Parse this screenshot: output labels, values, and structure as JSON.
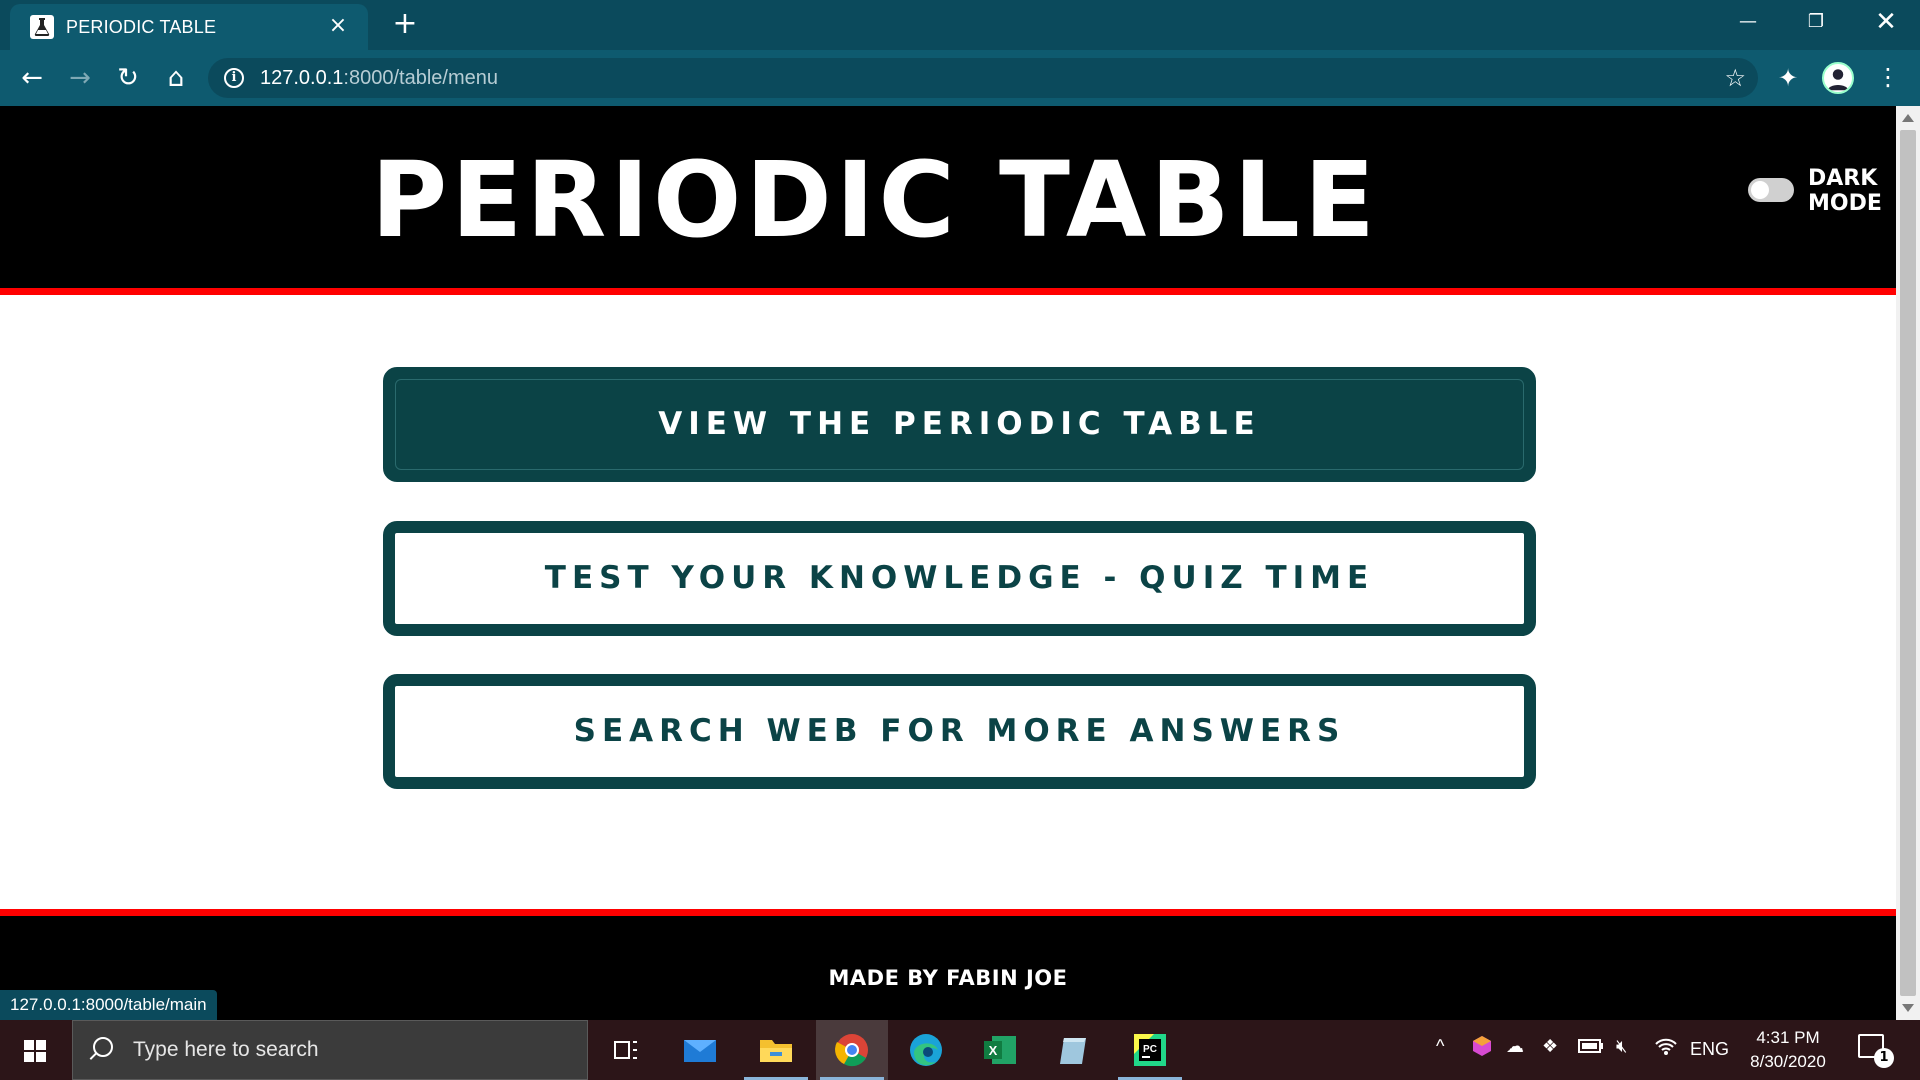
{
  "browser": {
    "tab_title": "PERIODIC TABLE",
    "tab_close": "×",
    "new_tab": "+",
    "url_host": "127.0.0.1",
    "url_rest": ":8000/table/menu",
    "status_url": "127.0.0.1:8000/table/main"
  },
  "page": {
    "title": "PERIODIC TABLE",
    "toggle_label_line1": "DARK",
    "toggle_label_line2": "MODE",
    "dark_mode_on": false,
    "buttons": [
      {
        "label": "VIEW THE PERIODIC TABLE",
        "style": "filled"
      },
      {
        "label": "TEST YOUR KNOWLEDGE - QUIZ TIME",
        "style": "outline"
      },
      {
        "label": "SEARCH WEB FOR MORE ANSWERS",
        "style": "outline"
      }
    ],
    "footer": "MADE BY FABIN JOE"
  },
  "colors": {
    "header_bg": "#000000",
    "accent_red": "#ff0000",
    "button_teal": "#0b4346",
    "chrome_teal": "#0e5a6f"
  },
  "taskbar": {
    "search_placeholder": "Type here to search",
    "language": "ENG",
    "time": "4:31 PM",
    "date": "8/30/2020",
    "notification_count": "1",
    "apps": [
      "task-view-icon",
      "mail-icon",
      "file-explorer-icon",
      "chrome-icon",
      "edge-icon",
      "excel-icon",
      "notepad-icon",
      "pycharm-icon"
    ]
  }
}
